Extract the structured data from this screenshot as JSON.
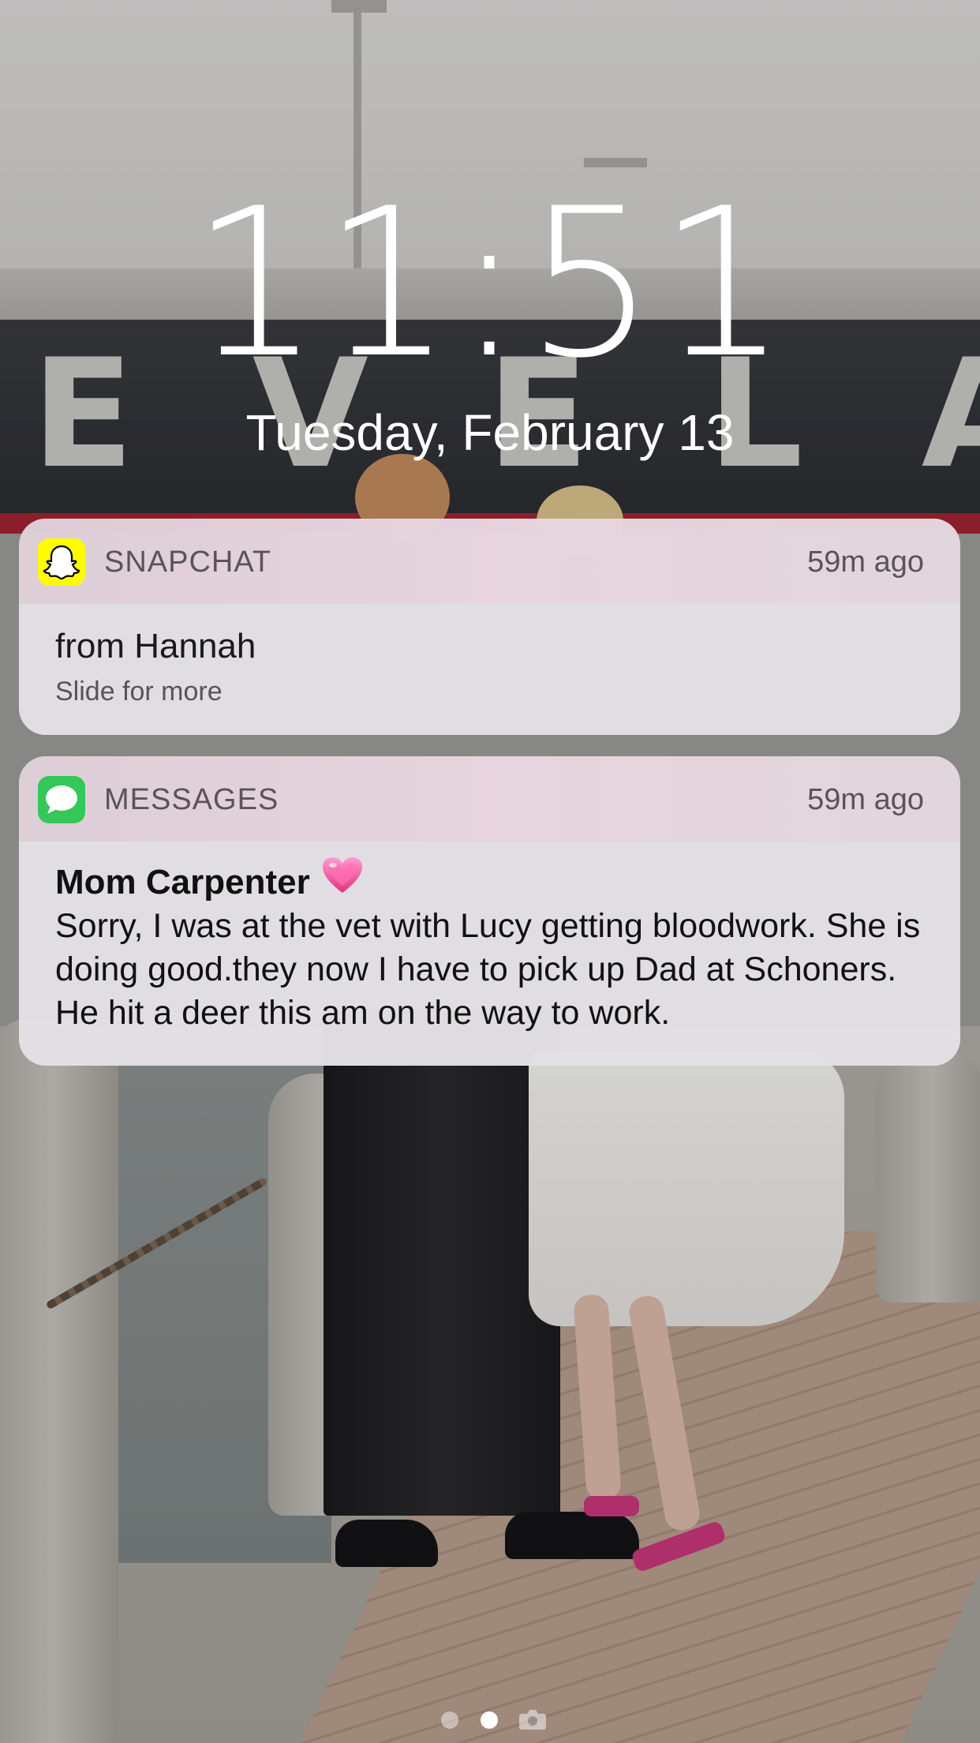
{
  "lockscreen": {
    "time": "11:51",
    "date": "Tuesday, February 13"
  },
  "notifications": [
    {
      "app": "SNAPCHAT",
      "icon": "snapchat-ghost-icon",
      "icon_color": "#FFFC00",
      "time_ago": "59m ago",
      "title": "from Hannah",
      "subtitle": "Slide for more"
    },
    {
      "app": "MESSAGES",
      "icon": "messages-bubble-icon",
      "icon_color": "#34C759",
      "time_ago": "59m ago",
      "sender": "Mom Carpenter",
      "sender_emoji": "pink-heart-emoji",
      "text": "Sorry, I was at the vet with Lucy getting bloodwork. She is doing good.they now I have to pick up Dad at Schoners. He hit a deer this am on the way to work."
    }
  ],
  "page_indicator": {
    "pages": 2,
    "current": 2,
    "camera_icon": "camera-icon"
  },
  "wallpaper": {
    "ship_lettering": "EVELA"
  }
}
